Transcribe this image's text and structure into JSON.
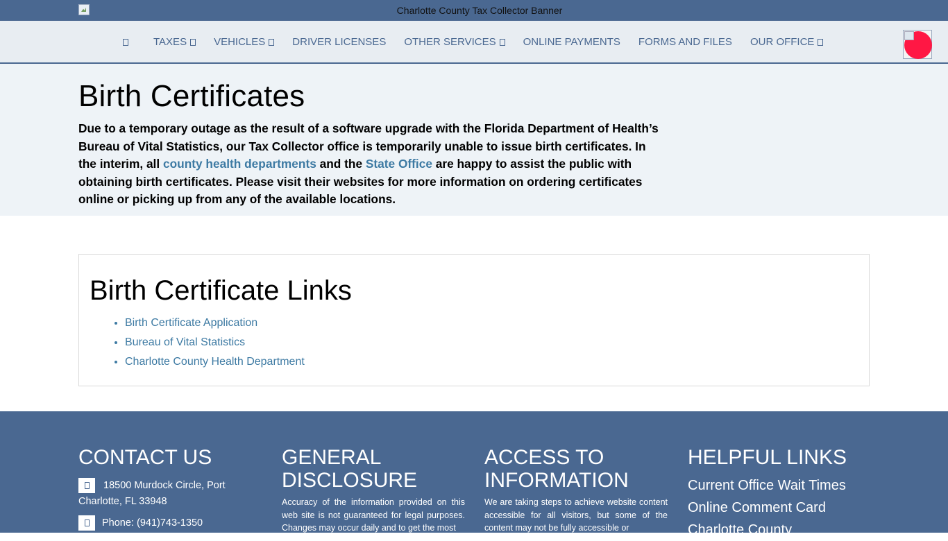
{
  "banner": {
    "alt_text": "Charlotte County Tax Collector Banner"
  },
  "nav": {
    "home_icon": "home-icon",
    "items": [
      {
        "label": "TAXES",
        "dropdown": true
      },
      {
        "label": "VEHICLES",
        "dropdown": true
      },
      {
        "label": "DRIVER LICENSES",
        "dropdown": false
      },
      {
        "label": "OTHER SERVICES",
        "dropdown": true
      },
      {
        "label": "ONLINE PAYMENTS",
        "dropdown": false
      },
      {
        "label": "FORMS AND FILES",
        "dropdown": false
      },
      {
        "label": "OUR OFFICE",
        "dropdown": true
      }
    ]
  },
  "notice": {
    "title": "Birth Certificates",
    "text_1": "Due to a temporary outage as the result of a software upgrade with the Florida Department of Health’s Bureau of Vital Statistics, our Tax Collector office is temporarily unable to issue birth certificates. In the interim, all ",
    "link_1": "county health departments",
    "text_2": " and the ",
    "link_2": "State Office",
    "text_3": " are happy to assist the public with obtaining birth certificates. Please visit their websites for more information on ordering certificates online or picking up from any of the available locations."
  },
  "links_card": {
    "title": "Birth Certificate Links",
    "links": [
      "Birth Certificate Application",
      "Bureau of Vital Statistics",
      "Charlotte County Health Department"
    ]
  },
  "footer": {
    "contact": {
      "title": "CONTACT US",
      "address": "18500 Murdock Circle, Port Charlotte, FL 33948",
      "phone": "Phone: (941)743-1350"
    },
    "disclosure": {
      "title": "GENERAL DISCLOSURE",
      "text": "Accuracy of the information provided on this web site is not guaranteed for legal purposes. Changes may occur daily and to get the most"
    },
    "access": {
      "title": "ACCESS TO INFORMATION",
      "text": "We are taking steps to achieve website content accessible for all visitors, but some of the content may not be fully accessible or"
    },
    "helpful": {
      "title": "HELPFUL LINKS",
      "links": [
        "Current Office Wait Times",
        "Online Comment Card",
        "Charlotte County"
      ]
    }
  },
  "colors": {
    "brand": "#4a6891",
    "link": "#3d7aa3",
    "notice_bg": "#eef3f7",
    "accent_red": "#ff1744"
  }
}
